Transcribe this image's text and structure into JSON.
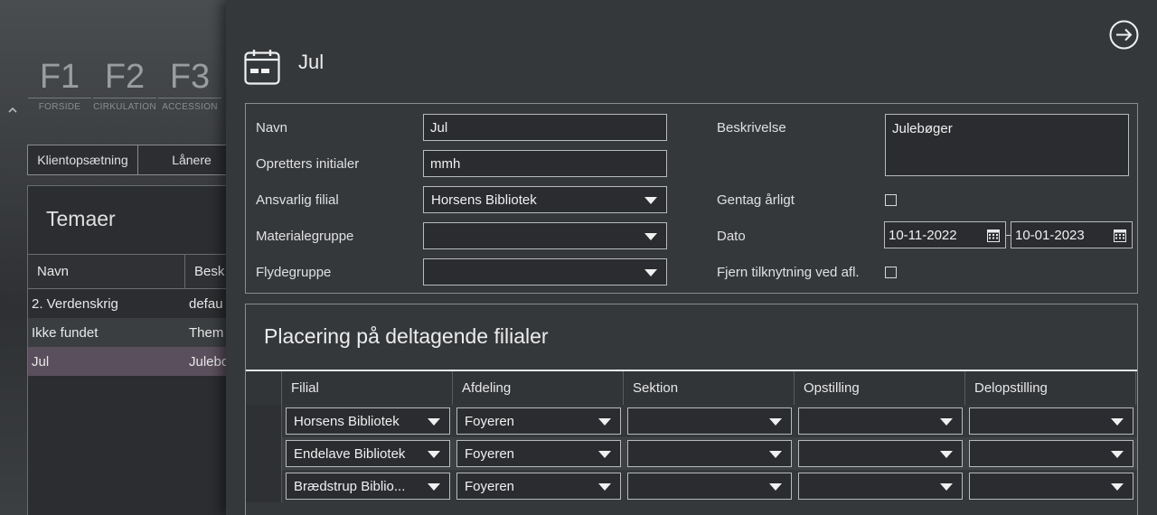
{
  "background": {
    "fkeys": [
      {
        "key": "F1",
        "label": "FORSIDE"
      },
      {
        "key": "F2",
        "label": "CIRKULATION"
      },
      {
        "key": "F3",
        "label": "ACCESSION"
      }
    ],
    "buttons": [
      "Klientopsætning",
      "Lånere"
    ],
    "panel_title": "Temaer",
    "columns": [
      "Navn",
      "Besk"
    ],
    "rows": [
      {
        "name": "2. Verdenskrig",
        "desc": "defau"
      },
      {
        "name": "Ikke fundet",
        "desc": "Them"
      },
      {
        "name": "Jul",
        "desc": "Julebo"
      }
    ]
  },
  "panel": {
    "title": "Jul",
    "form": {
      "navn_label": "Navn",
      "navn_value": "Jul",
      "initialer_label": "Opretters initialer",
      "initialer_value": "mmh",
      "filial_label": "Ansvarlig filial",
      "filial_value": "Horsens Bibliotek",
      "materiale_label": "Materialegruppe",
      "materiale_value": "",
      "flyde_label": "Flydegruppe",
      "flyde_value": "",
      "beskrivelse_label": "Beskrivelse",
      "beskrivelse_value": "Julebøger",
      "gentag_label": "Gentag årligt",
      "dato_label": "Dato",
      "dato_from": "10-11-2022",
      "dato_to": "10-01-2023",
      "fjern_label": "Fjern tilknytning ved afl."
    },
    "placement": {
      "title": "Placering på deltagende filialer",
      "columns": [
        "Filial",
        "Afdeling",
        "Sektion",
        "Opstilling",
        "Delopstilling"
      ],
      "rows": [
        {
          "filial": "Horsens Bibliotek",
          "afdeling": "Foyeren",
          "sektion": "",
          "opstilling": "",
          "delopstilling": ""
        },
        {
          "filial": "Endelave Bibliotek",
          "afdeling": "Foyeren",
          "sektion": "",
          "opstilling": "",
          "delopstilling": ""
        },
        {
          "filial": "Brædstrup Biblio...",
          "afdeling": "Foyeren",
          "sektion": "",
          "opstilling": "",
          "delopstilling": ""
        }
      ]
    }
  }
}
